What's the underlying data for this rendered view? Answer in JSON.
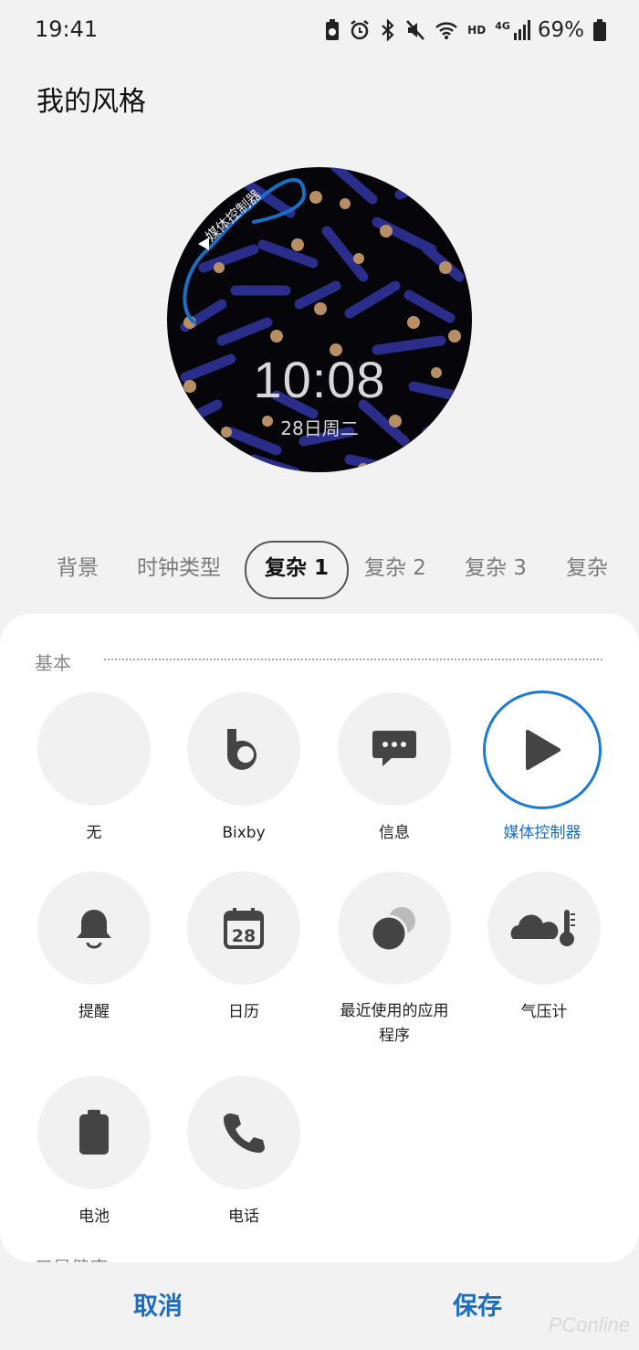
{
  "status_bar": {
    "time": "19:41",
    "battery": "69%",
    "network": "HD",
    "signal_type": "4G"
  },
  "page": {
    "title": "我的风格"
  },
  "watch_face": {
    "time": "10:08",
    "date": "28日周二",
    "complication_label": "媒体控制器",
    "colors": {
      "background": "#05050a",
      "stripes": "#2a2e8a",
      "dots": "#b88e64",
      "arc": "#1a6fc5"
    }
  },
  "tabs": [
    "背景",
    "时钟类型",
    "复杂 1",
    "复杂 2",
    "复杂 3",
    "复杂"
  ],
  "active_tab": "复杂 1",
  "sheet": {
    "section_title": "基本",
    "options": [
      {
        "label": "无",
        "icon": "none"
      },
      {
        "label": "Bixby",
        "icon": "bixby-icon"
      },
      {
        "label": "信息",
        "icon": "message-icon"
      },
      {
        "label": "媒体控制器",
        "icon": "play-icon",
        "selected": true
      },
      {
        "label": "提醒",
        "icon": "bell-icon"
      },
      {
        "label": "日历",
        "icon": "calendar-icon",
        "icon_text": "28"
      },
      {
        "label": "最近使用的应用程序",
        "label_line1": "最近使用的应用",
        "label_line2": "程序",
        "icon": "recent-apps-icon"
      },
      {
        "label": "气压计",
        "icon": "barometer-icon"
      },
      {
        "label": "电池",
        "icon": "battery-icon"
      },
      {
        "label": "电话",
        "icon": "phone-icon"
      }
    ],
    "next_section_title": "三星健康"
  },
  "bottom_bar": {
    "cancel_label": "取消",
    "save_label": "保存"
  },
  "watermark": "PConline",
  "accent_color": "#1a6fc5"
}
